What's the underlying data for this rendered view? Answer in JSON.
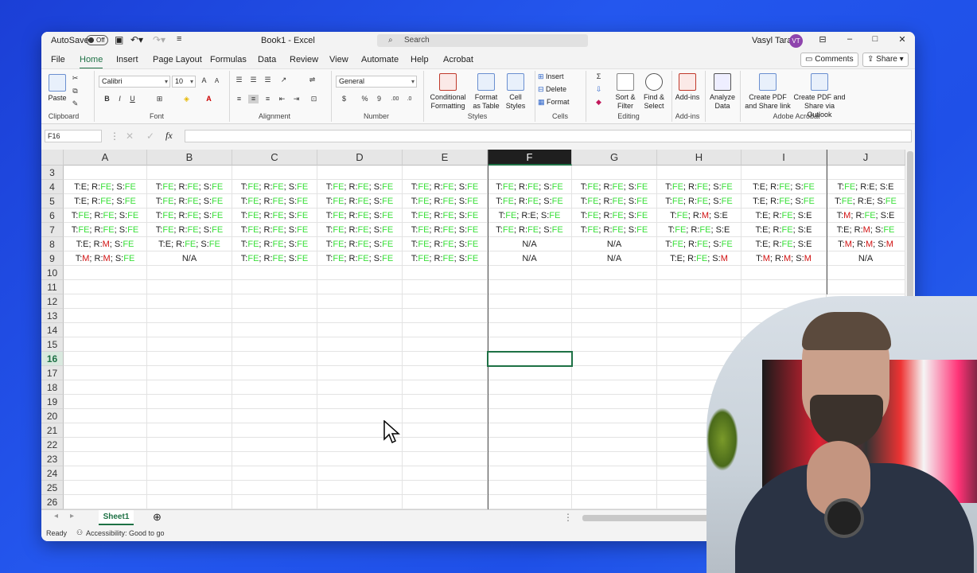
{
  "titlebar": {
    "autosave": "AutoSave",
    "autosave_state": "Off",
    "doc_title": "Book1 - Excel",
    "search": "Search",
    "user": "Vasyl Taras",
    "initials": "VT"
  },
  "menu": {
    "tabs": [
      "File",
      "Home",
      "Insert",
      "Page Layout",
      "Formulas",
      "Data",
      "Review",
      "View",
      "Automate",
      "Help",
      "Acrobat"
    ],
    "active": "Home",
    "comments": "Comments",
    "share": "Share"
  },
  "ribbon": {
    "clipboard": {
      "paste": "Paste",
      "group": "Clipboard"
    },
    "font": {
      "name": "Calibri",
      "size": "10",
      "group": "Font"
    },
    "alignment": {
      "group": "Alignment"
    },
    "number": {
      "format": "General",
      "group": "Number"
    },
    "styles": {
      "conditional": "Conditional Formatting",
      "format_table": "Format as Table",
      "cell_styles": "Cell Styles",
      "group": "Styles"
    },
    "cells": {
      "insert": "Insert",
      "delete": "Delete",
      "format": "Format",
      "group": "Cells"
    },
    "editing": {
      "sort": "Sort & Filter",
      "find": "Find & Select",
      "group": "Editing"
    },
    "addins": {
      "addins": "Add-ins",
      "group": "Add-ins"
    },
    "analyze": {
      "label": "Analyze Data"
    },
    "acrobat": {
      "create_pdf": "Create PDF and Share link",
      "create_pdf_outlook": "Create PDF and Share via Outlook",
      "group": "Adobe Acrobat"
    }
  },
  "formula_bar": {
    "namebox": "F16",
    "fx": "fx",
    "value": ""
  },
  "columns": [
    "A",
    "B",
    "C",
    "D",
    "E",
    "F",
    "G",
    "H",
    "I",
    "J"
  ],
  "selected_column": "F",
  "selected_row": "16",
  "rows": [
    {
      "n": "3",
      "cells": [
        "",
        "",
        "",
        "",
        "",
        "",
        "",
        "",
        "",
        ""
      ]
    },
    {
      "n": "4",
      "cells": [
        "T:E; R:FE; S:FE",
        "T:FE; R:FE; S:FE",
        "T:FE; R:FE; S:FE",
        "T:FE; R:FE; S:FE",
        "T:FE; R:FE; S:FE",
        "T:FE; R:FE; S:FE",
        "T:FE; R:FE; S:FE",
        "T:FE; R:FE; S:FE",
        "T:E; R:FE; S:FE",
        "T:FE; R:E; S:E"
      ]
    },
    {
      "n": "5",
      "cells": [
        "T:E; R:FE; S:FE",
        "T:FE; R:FE; S:FE",
        "T:FE; R:FE; S:FE",
        "T:FE; R:FE; S:FE",
        "T:FE; R:FE; S:FE",
        "T:FE; R:FE; S:FE",
        "T:FE; R:FE; S:FE",
        "T:FE; R:FE; S:FE",
        "T:E; R:FE; S:FE",
        "T:FE; R:E; S:FE"
      ]
    },
    {
      "n": "6",
      "cells": [
        "T:FE; R:FE; S:FE",
        "T:FE; R:FE; S:FE",
        "T:FE; R:FE; S:FE",
        "T:FE; R:FE; S:FE",
        "T:FE; R:FE; S:FE",
        "T:FE; R:E; S:FE",
        "T:FE; R:FE; S:FE",
        "T:FE; R:M; S:E",
        "T:E; R:FE; S:E",
        "T:M; R:FE; S:E"
      ]
    },
    {
      "n": "7",
      "cells": [
        "T:FE; R:FE; S:FE",
        "T:FE; R:FE; S:FE",
        "T:FE; R:FE; S:FE",
        "T:FE; R:FE; S:FE",
        "T:FE; R:FE; S:FE",
        "T:FE; R:FE; S:FE",
        "T:FE; R:FE; S:FE",
        "T:FE; R:FE; S:E",
        "T:E; R:FE; S:E",
        "T:E; R:M; S:FE"
      ]
    },
    {
      "n": "8",
      "cells": [
        "T:E; R:M; S:FE",
        "T:E; R:FE; S:FE",
        "T:FE; R:FE; S:FE",
        "T:FE; R:FE; S:FE",
        "T:FE; R:FE; S:FE",
        "N/A",
        "N/A",
        "T:FE; R:FE; S:FE",
        "T:E; R:FE; S:E",
        "T:M; R:M; S:M"
      ]
    },
    {
      "n": "9",
      "cells": [
        "T:M; R:M; S:FE",
        "N/A",
        "T:FE; R:FE; S:FE",
        "T:FE; R:FE; S:FE",
        "T:FE; R:FE; S:FE",
        "N/A",
        "N/A",
        "T:E; R:FE; S:M",
        "T:M; R:M; S:M",
        "N/A"
      ]
    },
    {
      "n": "10",
      "cells": [
        "",
        "",
        "",
        "",
        "",
        "",
        "",
        "",
        "",
        ""
      ]
    },
    {
      "n": "11",
      "cells": [
        "",
        "",
        "",
        "",
        "",
        "",
        "",
        "",
        "",
        ""
      ]
    },
    {
      "n": "12",
      "cells": [
        "",
        "",
        "",
        "",
        "",
        "",
        "",
        "",
        "",
        ""
      ]
    },
    {
      "n": "13",
      "cells": [
        "",
        "",
        "",
        "",
        "",
        "",
        "",
        "",
        "",
        ""
      ]
    },
    {
      "n": "14",
      "cells": [
        "",
        "",
        "",
        "",
        "",
        "",
        "",
        "",
        "",
        ""
      ]
    },
    {
      "n": "15",
      "cells": [
        "",
        "",
        "",
        "",
        "",
        "",
        "",
        "",
        "",
        ""
      ]
    },
    {
      "n": "16",
      "cells": [
        "",
        "",
        "",
        "",
        "",
        "",
        "",
        "",
        "",
        ""
      ]
    },
    {
      "n": "17",
      "cells": [
        "",
        "",
        "",
        "",
        "",
        "",
        "",
        "",
        "",
        ""
      ]
    },
    {
      "n": "18",
      "cells": [
        "",
        "",
        "",
        "",
        "",
        "",
        "",
        "",
        "",
        ""
      ]
    },
    {
      "n": "19",
      "cells": [
        "",
        "",
        "",
        "",
        "",
        "",
        "",
        "",
        "",
        ""
      ]
    },
    {
      "n": "20",
      "cells": [
        "",
        "",
        "",
        "",
        "",
        "",
        "",
        "",
        "",
        ""
      ]
    },
    {
      "n": "21",
      "cells": [
        "",
        "",
        "",
        "",
        "",
        "",
        "",
        "",
        "",
        ""
      ]
    },
    {
      "n": "22",
      "cells": [
        "",
        "",
        "",
        "",
        "",
        "",
        "",
        "",
        "",
        ""
      ]
    },
    {
      "n": "23",
      "cells": [
        "",
        "",
        "",
        "",
        "",
        "",
        "",
        "",
        "",
        ""
      ]
    },
    {
      "n": "24",
      "cells": [
        "",
        "",
        "",
        "",
        "",
        "",
        "",
        "",
        "",
        ""
      ]
    },
    {
      "n": "25",
      "cells": [
        "",
        "",
        "",
        "",
        "",
        "",
        "",
        "",
        "",
        ""
      ]
    },
    {
      "n": "26",
      "cells": [
        "",
        "",
        "",
        "",
        "",
        "",
        "",
        "",
        "",
        ""
      ]
    }
  ],
  "sheets": {
    "active": "Sheet1"
  },
  "status": {
    "ready": "Ready",
    "accessibility": "Accessibility: Good to go"
  },
  "colors": {
    "code_m": "#d01010",
    "code_fe": "#3adf3a",
    "accent": "#1e7145"
  }
}
